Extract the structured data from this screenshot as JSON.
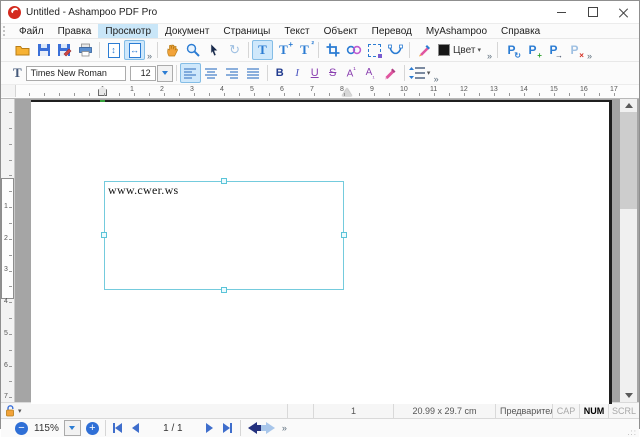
{
  "window": {
    "title": "Untitled - Ashampoo PDF Pro"
  },
  "menu": {
    "items": [
      "Файл",
      "Правка",
      "Просмотр",
      "Документ",
      "Страницы",
      "Текст",
      "Объект",
      "Перевод",
      "MyAshampoo",
      "Справка"
    ],
    "active_index": 2
  },
  "glyphs": {
    "overflow": "»",
    "dropdown": "▾",
    "fit_vertical": "↕",
    "fit_horizontal": "↔",
    "rotate": "↻",
    "letter_T": "T",
    "plus": "+",
    "superscript_two": "²",
    "letter_P": "P",
    "refresh": "↻",
    "arrow_right": "→",
    "cross": "×",
    "bold": "B",
    "italic": "I",
    "underline": "U",
    "strike": "S",
    "letter_A": "A",
    "sup_mark": "¹",
    "sub_mark": "₁",
    "minus": "−",
    "grip_dots": ".::"
  },
  "format": {
    "font_name": "Times New Roman",
    "font_size": "12",
    "color_label": "Цвет"
  },
  "ruler": {
    "h_numbers": [
      1,
      2,
      3,
      4,
      5,
      6,
      7,
      8,
      9,
      10,
      11,
      12,
      13,
      14,
      15,
      16,
      17
    ],
    "v_numbers": [
      1,
      2,
      3,
      4,
      5,
      6,
      7
    ]
  },
  "page": {
    "textbox_text": "www.cwer.ws"
  },
  "statusbar": {
    "page_number": "1",
    "page_size": "20.99 x 29.7 cm",
    "preview_label": "Предварител",
    "caps": "CAP",
    "num": "NUM",
    "scrl": "SCRL"
  },
  "bottombar": {
    "zoom_level": "115%",
    "page_indicator": "1 / 1"
  },
  "colors": {
    "selection_cyan": "#74cbdd",
    "menu_highlight": "#c9e6f8",
    "icon_blue": "#2b7cd3",
    "accent_orange": "#f2a33a",
    "logo_red": "#d42a1e"
  }
}
